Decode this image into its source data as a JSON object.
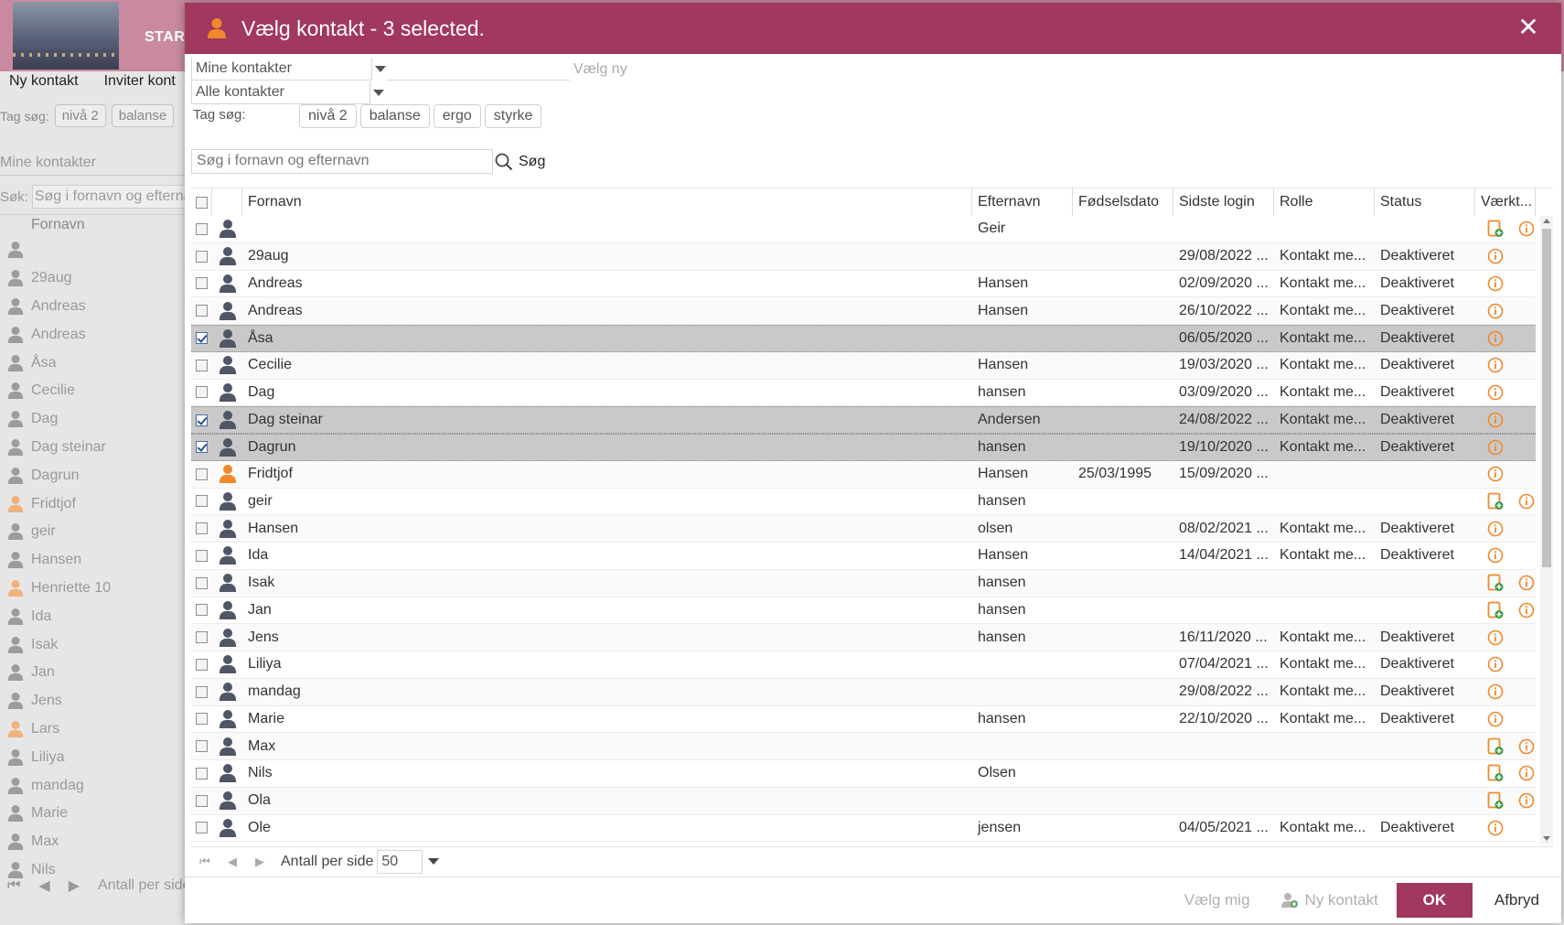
{
  "background": {
    "header_label": "START",
    "toolbar": [
      "Ny kontakt",
      "Inviter kont"
    ],
    "tag_label": "Tag søg:",
    "tags": [
      "nivå 2",
      "balanse"
    ],
    "select_value": "Mine kontakter",
    "search_label": "Søk:",
    "search_placeholder": "Søg i fornavn og efterna",
    "column_header": "Fornavn",
    "rows": [
      {
        "name": "",
        "icon": "user-gray"
      },
      {
        "name": "29aug",
        "icon": "user-gray"
      },
      {
        "name": "Andreas",
        "icon": "user-gray"
      },
      {
        "name": "Andreas",
        "icon": "user-gray"
      },
      {
        "name": "Åsa",
        "icon": "user-gray"
      },
      {
        "name": "Cecilie",
        "icon": "user-gray"
      },
      {
        "name": "Dag",
        "icon": "user-gray"
      },
      {
        "name": "Dag steinar",
        "icon": "user-gray"
      },
      {
        "name": "Dagrun",
        "icon": "user-gray"
      },
      {
        "name": "Fridtjof",
        "icon": "user-orange"
      },
      {
        "name": "geir",
        "icon": "user-gray"
      },
      {
        "name": "Hansen",
        "icon": "user-gray"
      },
      {
        "name": "Henriette 10",
        "icon": "user-orange"
      },
      {
        "name": "Ida",
        "icon": "user-gray"
      },
      {
        "name": "Isak",
        "icon": "user-gray"
      },
      {
        "name": "Jan",
        "icon": "user-gray"
      },
      {
        "name": "Jens",
        "icon": "user-gray"
      },
      {
        "name": "Lars",
        "icon": "user-orange"
      },
      {
        "name": "Liliya",
        "icon": "user-gray"
      },
      {
        "name": "mandag",
        "icon": "user-gray"
      },
      {
        "name": "Marie",
        "icon": "user-gray"
      },
      {
        "name": "Max",
        "icon": "user-gray"
      },
      {
        "name": "Nils",
        "icon": "user-gray"
      }
    ],
    "pager_label": "Antall per side"
  },
  "modal": {
    "title": "Vælg kontakt - 3 selected.",
    "title_icon": "user-orange-icon",
    "close_label": "✕",
    "filter_scope": "Mine kontakter",
    "filter_new_label": "Vælg ny",
    "filter_type": "Alle kontakter",
    "tag_label": "Tag søg:",
    "tags": [
      "nivå 2",
      "balanse",
      "ergo",
      "styrke"
    ],
    "search_placeholder": "Søg i fornavn og efternavn",
    "search_button": "Søg",
    "columns": {
      "firstname": "Fornavn",
      "lastname": "Efternavn",
      "birthdate": "Fødselsdato",
      "last_login": "Sidste login",
      "role": "Rolle",
      "status": "Status",
      "tools": "Værkt..."
    },
    "rows": [
      {
        "checked": false,
        "icon": "user-dark",
        "firstname": "",
        "lastname": "Geir",
        "birthdate": "",
        "last_login": "",
        "role": "",
        "status": "",
        "tools": [
          "add-contact-icon",
          "info-icon"
        ]
      },
      {
        "checked": false,
        "icon": "user-dark",
        "firstname": "29aug",
        "lastname": "",
        "birthdate": "",
        "last_login": "29/08/2022 ...",
        "role": "Kontakt me...",
        "status": "Deaktiveret",
        "tools": [
          "info-icon"
        ]
      },
      {
        "checked": false,
        "icon": "user-dark",
        "firstname": "Andreas",
        "lastname": "Hansen",
        "birthdate": "",
        "last_login": "02/09/2020 ...",
        "role": "Kontakt me...",
        "status": "Deaktiveret",
        "tools": [
          "info-icon"
        ]
      },
      {
        "checked": false,
        "icon": "user-dark",
        "firstname": "Andreas",
        "lastname": "Hansen",
        "birthdate": "",
        "last_login": "26/10/2022 ...",
        "role": "Kontakt me...",
        "status": "Deaktiveret",
        "tools": [
          "info-icon"
        ]
      },
      {
        "checked": true,
        "icon": "user-dark",
        "firstname": "Åsa",
        "lastname": "",
        "birthdate": "",
        "last_login": "06/05/2020 ...",
        "role": "Kontakt me...",
        "status": "Deaktiveret",
        "tools": [
          "info-icon"
        ]
      },
      {
        "checked": false,
        "icon": "user-dark",
        "firstname": "Cecilie",
        "lastname": "Hansen",
        "birthdate": "",
        "last_login": "19/03/2020 ...",
        "role": "Kontakt me...",
        "status": "Deaktiveret",
        "tools": [
          "info-icon"
        ]
      },
      {
        "checked": false,
        "icon": "user-dark",
        "firstname": "Dag",
        "lastname": "hansen",
        "birthdate": "",
        "last_login": "03/09/2020 ...",
        "role": "Kontakt me...",
        "status": "Deaktiveret",
        "tools": [
          "info-icon"
        ]
      },
      {
        "checked": true,
        "icon": "user-dark",
        "firstname": "Dag steinar",
        "lastname": "Andersen",
        "birthdate": "",
        "last_login": "24/08/2022 ...",
        "role": "Kontakt me...",
        "status": "Deaktiveret",
        "tools": [
          "info-icon"
        ]
      },
      {
        "checked": true,
        "icon": "user-dark",
        "firstname": "Dagrun",
        "lastname": "hansen",
        "birthdate": "",
        "last_login": "19/10/2020 ...",
        "role": "Kontakt me...",
        "status": "Deaktiveret",
        "tools": [
          "info-icon"
        ]
      },
      {
        "checked": false,
        "icon": "user-orange",
        "firstname": "Fridtjof",
        "lastname": "Hansen",
        "birthdate": "25/03/1995",
        "last_login": "15/09/2020 ...",
        "role": "",
        "status": "",
        "tools": [
          "info-icon"
        ]
      },
      {
        "checked": false,
        "icon": "user-dark",
        "firstname": "geir",
        "lastname": "hansen",
        "birthdate": "",
        "last_login": "",
        "role": "",
        "status": "",
        "tools": [
          "add-contact-icon",
          "info-icon"
        ]
      },
      {
        "checked": false,
        "icon": "user-dark",
        "firstname": "Hansen",
        "lastname": "olsen",
        "birthdate": "",
        "last_login": "08/02/2021 ...",
        "role": "Kontakt me...",
        "status": "Deaktiveret",
        "tools": [
          "info-icon"
        ]
      },
      {
        "checked": false,
        "icon": "user-dark",
        "firstname": "Ida",
        "lastname": "Hansen",
        "birthdate": "",
        "last_login": "14/04/2021 ...",
        "role": "Kontakt me...",
        "status": "Deaktiveret",
        "tools": [
          "info-icon"
        ]
      },
      {
        "checked": false,
        "icon": "user-dark",
        "firstname": "Isak",
        "lastname": "hansen",
        "birthdate": "",
        "last_login": "",
        "role": "",
        "status": "",
        "tools": [
          "add-contact-icon",
          "info-icon"
        ]
      },
      {
        "checked": false,
        "icon": "user-dark",
        "firstname": "Jan",
        "lastname": "hansen",
        "birthdate": "",
        "last_login": "",
        "role": "",
        "status": "",
        "tools": [
          "add-contact-icon",
          "info-icon"
        ]
      },
      {
        "checked": false,
        "icon": "user-dark",
        "firstname": "Jens",
        "lastname": "hansen",
        "birthdate": "",
        "last_login": "16/11/2020 ...",
        "role": "Kontakt me...",
        "status": "Deaktiveret",
        "tools": [
          "info-icon"
        ]
      },
      {
        "checked": false,
        "icon": "user-dark",
        "firstname": "Liliya",
        "lastname": "",
        "birthdate": "",
        "last_login": "07/04/2021 ...",
        "role": "Kontakt me...",
        "status": "Deaktiveret",
        "tools": [
          "info-icon"
        ]
      },
      {
        "checked": false,
        "icon": "user-dark",
        "firstname": "mandag",
        "lastname": "",
        "birthdate": "",
        "last_login": "29/08/2022 ...",
        "role": "Kontakt me...",
        "status": "Deaktiveret",
        "tools": [
          "info-icon"
        ]
      },
      {
        "checked": false,
        "icon": "user-dark",
        "firstname": "Marie",
        "lastname": "hansen",
        "birthdate": "",
        "last_login": "22/10/2020 ...",
        "role": "Kontakt me...",
        "status": "Deaktiveret",
        "tools": [
          "info-icon"
        ]
      },
      {
        "checked": false,
        "icon": "user-dark",
        "firstname": "Max",
        "lastname": "",
        "birthdate": "",
        "last_login": "",
        "role": "",
        "status": "",
        "tools": [
          "add-contact-icon",
          "info-icon"
        ]
      },
      {
        "checked": false,
        "icon": "user-dark",
        "firstname": "Nils",
        "lastname": "Olsen",
        "birthdate": "",
        "last_login": "",
        "role": "",
        "status": "",
        "tools": [
          "add-contact-icon",
          "info-icon"
        ]
      },
      {
        "checked": false,
        "icon": "user-dark",
        "firstname": "Ola",
        "lastname": "",
        "birthdate": "",
        "last_login": "",
        "role": "",
        "status": "",
        "tools": [
          "add-contact-icon",
          "info-icon"
        ]
      },
      {
        "checked": false,
        "icon": "user-dark",
        "firstname": "Ole",
        "lastname": "jensen",
        "birthdate": "",
        "last_login": "04/05/2021 ...",
        "role": "Kontakt me...",
        "status": "Deaktiveret",
        "tools": [
          "info-icon"
        ]
      }
    ],
    "pager": {
      "per_page_label": "Antall per side",
      "per_page_value": "50"
    },
    "footer": {
      "select_me": "Vælg mig",
      "new_contact": "Ny kontakt",
      "ok": "OK",
      "cancel": "Afbryd"
    }
  },
  "colors": {
    "accent": "#a0385f",
    "header_faded": "#c98aa0",
    "orange": "#f0892b",
    "user_dark": "#4f5666",
    "selected_row": "#c9c9c9"
  }
}
